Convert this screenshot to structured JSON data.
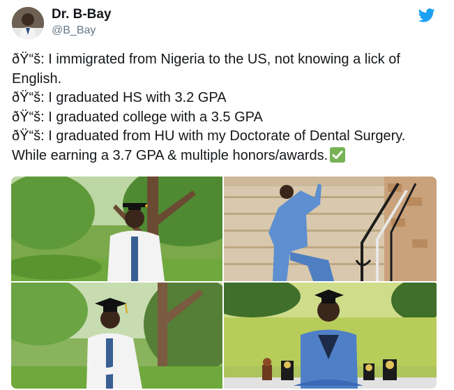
{
  "author": {
    "name": "Dr. B-Bay",
    "handle": "@B_Bay",
    "avatar_icon": "avatar-photo"
  },
  "tweet": {
    "lines": [
      "ðŸ“š: I immigrated from Nigeria to the US, not knowing a lick of",
      "English.",
      "ðŸ“š: I graduated HS with 3.2 GPA",
      "ðŸ“š: I graduated college with a 3.5 GPA",
      "ðŸ“š: I graduated from HU with my Doctorate of Dental Surgery.",
      "While earning a 3.7 GPA & multiple honors/awards."
    ],
    "check_icon": "check-mark-button-emoji"
  },
  "brand": {
    "icon": "twitter-bird-icon",
    "color": "#1da1f2"
  },
  "photos": [
    {
      "name": "photo-white-coat-tree",
      "icon": "photo"
    },
    {
      "name": "photo-blue-suit-stairs",
      "icon": "photo"
    },
    {
      "name": "photo-white-coat-cap",
      "icon": "photo"
    },
    {
      "name": "photo-blue-suit-awards",
      "icon": "photo"
    }
  ]
}
